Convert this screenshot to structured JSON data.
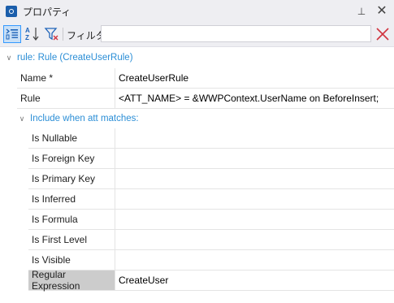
{
  "window": {
    "title": "プロパティ",
    "pin_glyph": "⊥",
    "close_glyph": "✕"
  },
  "toolbar": {
    "categorized_icon": "categorized-view-icon",
    "alphabetical_icon": "sort-alphabetical-icon",
    "filter_icon": "filter-icon",
    "filter_label": "フィルタ",
    "filter_value": "",
    "clear_icon": "clear-filter-icon"
  },
  "grid": {
    "category": "rule: Rule (CreateUserRule)",
    "rows": [
      {
        "name": "Name *",
        "value": "CreateUserRule"
      },
      {
        "name": "Rule",
        "value": "<ATT_NAME> = &WWPContext.UserName on BeforeInsert;"
      }
    ],
    "subcategory": "Include when att matches:",
    "subrows": [
      {
        "name": "Is Nullable",
        "value": ""
      },
      {
        "name": "Is Foreign Key",
        "value": ""
      },
      {
        "name": "Is Primary Key",
        "value": ""
      },
      {
        "name": "Is Inferred",
        "value": ""
      },
      {
        "name": "Is Formula",
        "value": ""
      },
      {
        "name": "Is First Level",
        "value": ""
      },
      {
        "name": "Is Visible",
        "value": ""
      },
      {
        "name": "Regular Expression",
        "value": "CreateUser"
      }
    ]
  },
  "colors": {
    "accent": "#2b8ed6",
    "selected_bg": "#cccccc",
    "clear_x": "#d0343f"
  }
}
